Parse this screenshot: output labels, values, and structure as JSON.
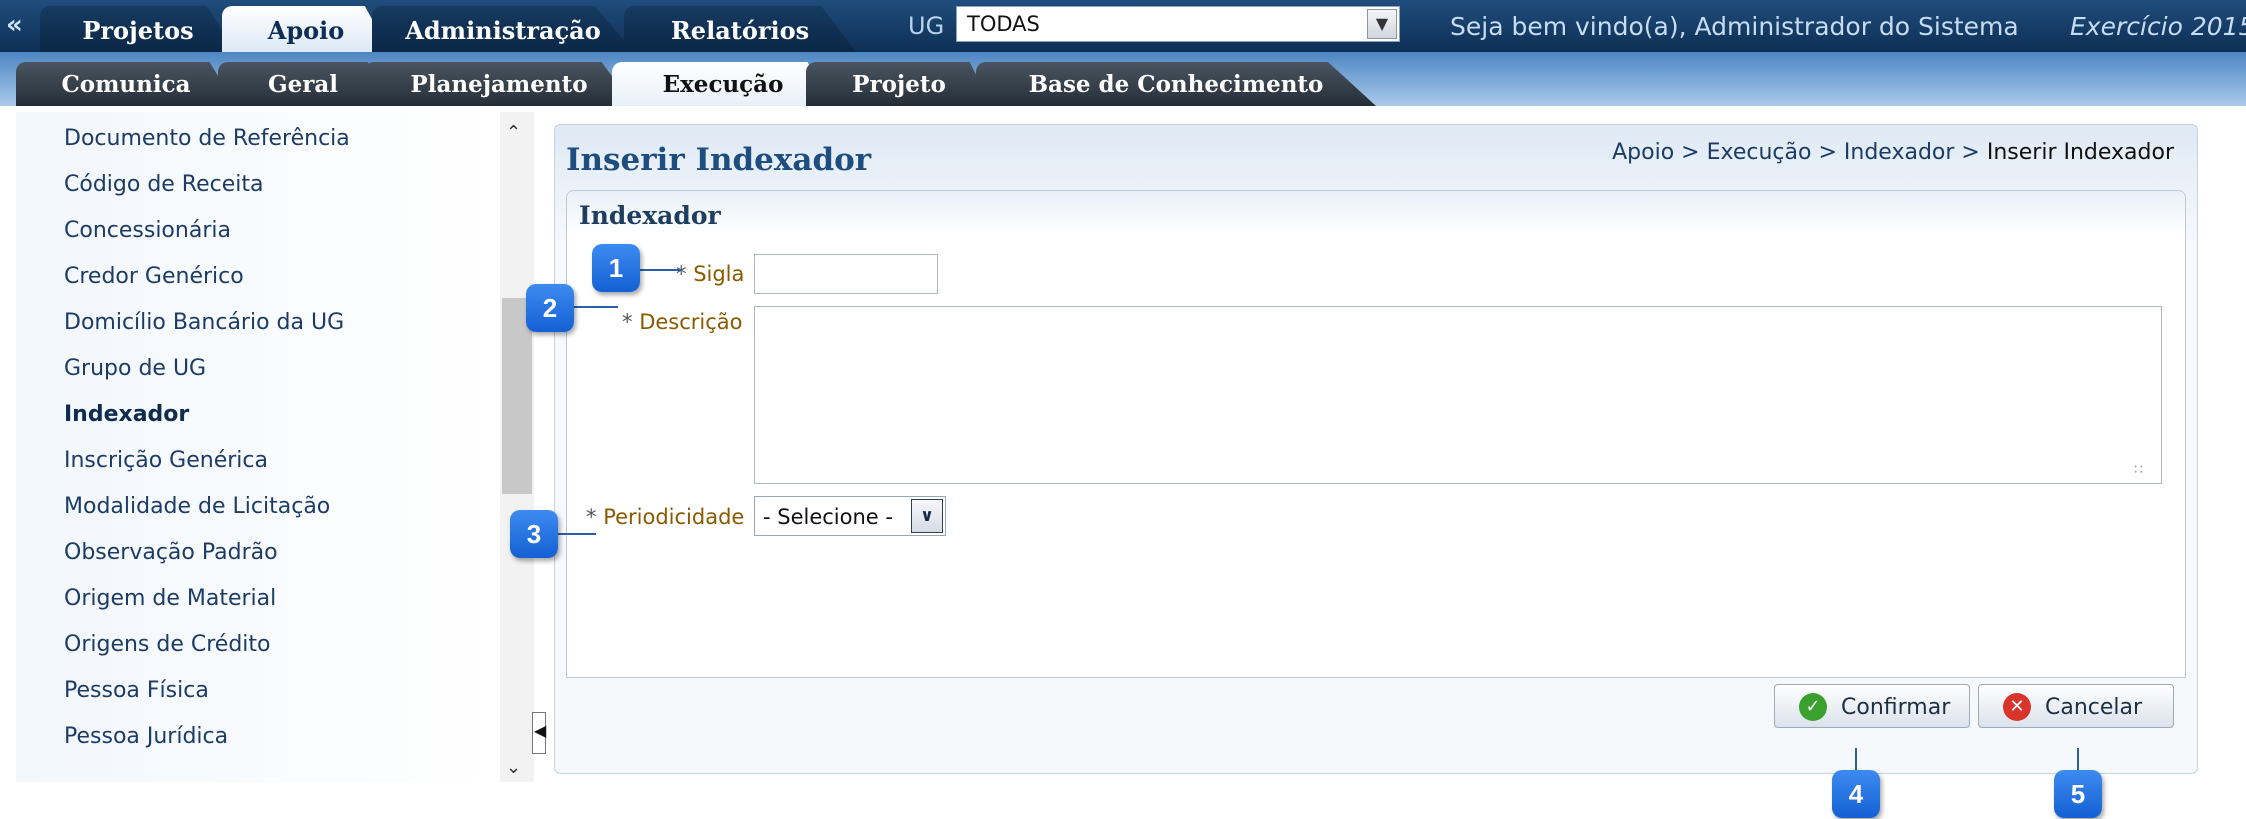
{
  "top_nav": {
    "collapse": "«",
    "tabs": [
      {
        "label": "Projetos",
        "active": false
      },
      {
        "label": "Apoio",
        "active": true
      },
      {
        "label": "Administração",
        "active": false
      },
      {
        "label": "Relatórios",
        "active": false
      }
    ],
    "ug_label": "UG",
    "ug_value": "TODAS",
    "welcome": "Seja bem vindo(a), Administrador do Sistema",
    "exercise": "Exercício 2015"
  },
  "sub_nav": {
    "tabs": [
      {
        "label": "Comunica",
        "active": false
      },
      {
        "label": "Geral",
        "active": false
      },
      {
        "label": "Planejamento",
        "active": false
      },
      {
        "label": "Execução",
        "active": true
      },
      {
        "label": "Projeto",
        "active": false
      },
      {
        "label": "Base de Conhecimento",
        "active": false
      }
    ]
  },
  "sidebar": {
    "items": [
      {
        "label": "Documento de Referência",
        "selected": false
      },
      {
        "label": "Código de Receita",
        "selected": false
      },
      {
        "label": "Concessionária",
        "selected": false
      },
      {
        "label": "Credor Genérico",
        "selected": false
      },
      {
        "label": "Domicílio Bancário da UG",
        "selected": false
      },
      {
        "label": "Grupo de UG",
        "selected": false
      },
      {
        "label": "Indexador",
        "selected": true
      },
      {
        "label": "Inscrição Genérica",
        "selected": false
      },
      {
        "label": "Modalidade de Licitação",
        "selected": false
      },
      {
        "label": "Observação Padrão",
        "selected": false
      },
      {
        "label": "Origem de Material",
        "selected": false
      },
      {
        "label": "Origens de Crédito",
        "selected": false
      },
      {
        "label": "Pessoa Física",
        "selected": false
      },
      {
        "label": "Pessoa Jurídica",
        "selected": false
      }
    ]
  },
  "page": {
    "title": "Inserir Indexador",
    "breadcrumb": [
      "Apoio",
      "Execução",
      "Indexador",
      "Inserir Indexador"
    ],
    "breadcrumb_sep": ">"
  },
  "form": {
    "title": "Indexador",
    "required_mark": "*",
    "sigla_label": "Sigla",
    "sigla_value": "",
    "descricao_label": "Descrição",
    "descricao_value": "",
    "periodicidade_label": "Periodicidade",
    "periodicidade_value": "- Selecione -"
  },
  "buttons": {
    "confirm": "Confirmar",
    "cancel": "Cancelar"
  },
  "callouts": [
    "1",
    "2",
    "3",
    "4",
    "5"
  ],
  "colors": {
    "header_dark": "#0e2f55",
    "label_text": "#8a5a00",
    "callout_blue": "#1f6fe0",
    "confirm_green": "#3aa02e",
    "cancel_red": "#d9342b"
  }
}
